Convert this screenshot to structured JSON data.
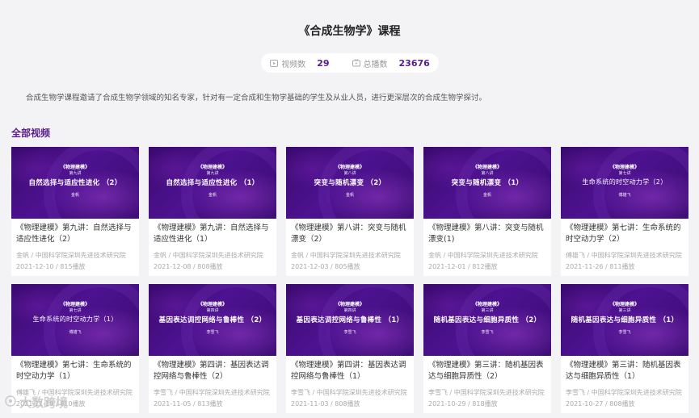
{
  "page": {
    "title": "《合成生物学》课程"
  },
  "stats": {
    "video_label": "视频数",
    "video_count": "29",
    "video_icon": "play-icon",
    "play_label": "总播数",
    "play_count": "23676",
    "play_icon": "tv-icon"
  },
  "description": "合成生物学课程邀请了合成生物学领域的知名专家，针对有一定合成和生物学基础的学生及从业人员，进行更深层次的合成生物学探讨。",
  "section_title": "全部视频",
  "videos": [
    {
      "thumb_series": "《物理建模》",
      "thumb_lecture": "第九讲",
      "thumb_title": "自然选择与适应性进化 （2）",
      "thumb_speaker": "金帆",
      "title": "《物理建模》第九讲：自然选择与适应性进化（2）",
      "author": "金帆 / 中国科学院深圳先进技术研究院",
      "date_plays": "2021-12-10 / 815播放"
    },
    {
      "thumb_series": "《物理建模》",
      "thumb_lecture": "第九讲",
      "thumb_title": "自然选择与适应性进化 （1）",
      "thumb_speaker": "金帆",
      "title": "《物理建模》第九讲：自然选择与适应性进化（1）",
      "author": "金帆 / 中国科学院深圳先进技术研究院",
      "date_plays": "2021-12-08 / 808播放"
    },
    {
      "thumb_series": "《物理建模》",
      "thumb_lecture": "第八讲",
      "thumb_title": "突变与随机漂变 （2）",
      "thumb_speaker": "金帆",
      "title": "《物理建模》第八讲：突变与随机漂变（2）",
      "author": "金帆 / 中国科学院深圳先进技术研究院",
      "date_plays": "2021-12-03 / 805播放"
    },
    {
      "thumb_series": "《物理建模》",
      "thumb_lecture": "第八讲",
      "thumb_title": "突变与随机漂变 （1）",
      "thumb_speaker": "金帆",
      "title": "《物理建模》第八讲：突变与随机漂变(1)",
      "author": "金帆 / 中国科学院深圳先进技术研究院",
      "date_plays": "2021-12-01 / 812播放"
    },
    {
      "thumb_series": "《物理建模》",
      "thumb_lecture": "第七讲",
      "thumb_title": "生命系统的时空动力学（2）",
      "thumb_speaker": "傅雄飞",
      "title": "《物理建模》第七讲：生命系统的时空动力学（2）",
      "author": "傅雄飞 / 中国科学院深圳先进技术研究院",
      "date_plays": "2021-11-26 / 811播放"
    },
    {
      "thumb_series": "《物理建模》",
      "thumb_lecture": "第七讲",
      "thumb_title": "生命系统的时空动力学（1）",
      "thumb_speaker": "傅雄飞",
      "title": "《物理建模》第七讲：生命系统的时空动力学（1）",
      "author": "傅雄飞 / 中国科学院深圳先进技术研究院",
      "date_plays": "2021-11-19 / 810播放"
    },
    {
      "thumb_series": "《物理建模》",
      "thumb_lecture": "第四讲",
      "thumb_title": "基因表达调控网络与鲁棒性 （2）",
      "thumb_speaker": "李雪飞",
      "title": "《物理建模》第四讲：基因表达调控网络与鲁棒性（2）",
      "author": "李雪飞 / 中国科学院深圳先进技术研究院",
      "date_plays": "2021-11-05 / 813播放"
    },
    {
      "thumb_series": "《物理建模》",
      "thumb_lecture": "第四讲",
      "thumb_title": "基因表达调控网络与鲁棒性 （1）",
      "thumb_speaker": "李雪飞",
      "title": "《物理建模》第四讲：基因表达调控网络与鲁棒性（1）",
      "author": "李雪飞 / 中国科学院深圳先进技术研究院",
      "date_plays": "2021-11-03 / 808播放"
    },
    {
      "thumb_series": "《物理建模》",
      "thumb_lecture": "第三讲",
      "thumb_title": "随机基因表达与细胞异质性 （2）",
      "thumb_speaker": "李雪飞",
      "title": "《物理建模》第三讲：随机基因表达与细胞异质性（2）",
      "author": "李雪飞 / 中国科学院深圳先进技术研究院",
      "date_plays": "2021-10-29 / 818播放"
    },
    {
      "thumb_series": "《物理建模》",
      "thumb_lecture": "第三讲",
      "thumb_title": "随机基因表达与细胞异质性 （1）",
      "thumb_speaker": "李雪飞",
      "title": "《物理建模》第三讲：随机基因表达与细胞异质性（1）",
      "author": "李雪飞 / 中国科学院深圳先进技术研究院",
      "date_plays": "2021-10-27 / 808播放"
    }
  ],
  "watermark": "大数跨境",
  "colors": {
    "accent": "#5a1c8e",
    "background": "#f3f3f5",
    "thumb": "#4d1290"
  }
}
